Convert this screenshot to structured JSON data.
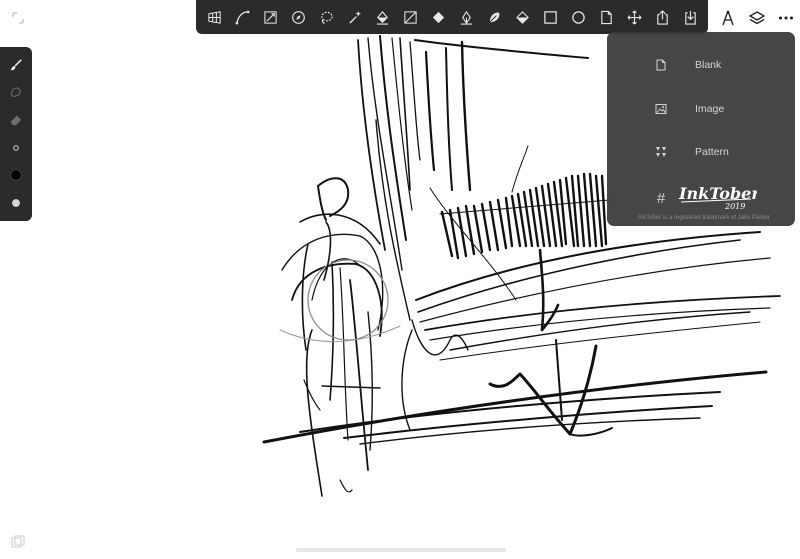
{
  "app": {
    "accent_color": "#2b2b2b",
    "menu_color": "#3a3a3a"
  },
  "top_toolbar": {
    "tools": [
      {
        "name": "perspective-grid-icon"
      },
      {
        "name": "curve-icon"
      },
      {
        "name": "transform-icon"
      },
      {
        "name": "compass-icon"
      },
      {
        "name": "lasso-select-icon"
      },
      {
        "name": "magic-wand-icon"
      },
      {
        "name": "paint-bucket-icon"
      },
      {
        "name": "gradient-square-icon"
      },
      {
        "name": "fill-drop-icon"
      },
      {
        "name": "vector-pen-icon"
      },
      {
        "name": "leaf-shape-icon"
      },
      {
        "name": "perspective-fill-icon"
      },
      {
        "name": "rectangle-shape-icon"
      },
      {
        "name": "ellipse-shape-icon"
      },
      {
        "name": "document-icon"
      },
      {
        "name": "move-icon"
      },
      {
        "name": "share-icon"
      },
      {
        "name": "import-icon"
      }
    ]
  },
  "right_utils": [
    {
      "name": "ruler-compass-icon"
    },
    {
      "name": "layers-icon"
    },
    {
      "name": "more-icon"
    }
  ],
  "left_toolbar": [
    {
      "name": "brush-icon"
    },
    {
      "name": "smudge-icon"
    },
    {
      "name": "eraser-icon"
    },
    {
      "name": "brush-size-icon"
    },
    {
      "name": "color-black-swatch"
    },
    {
      "name": "color-gray-swatch"
    }
  ],
  "new_layer_menu": {
    "items": [
      {
        "label": "Blank",
        "icon": "blank-page-icon"
      },
      {
        "label": "Image",
        "icon": "image-icon"
      },
      {
        "label": "Pattern",
        "icon": "pattern-icon"
      }
    ],
    "inktober": {
      "hash": "#",
      "logo_title": "InkTober",
      "logo_year": "2019",
      "caption": "InkTober is a registered trademark of Jake Parker"
    }
  }
}
